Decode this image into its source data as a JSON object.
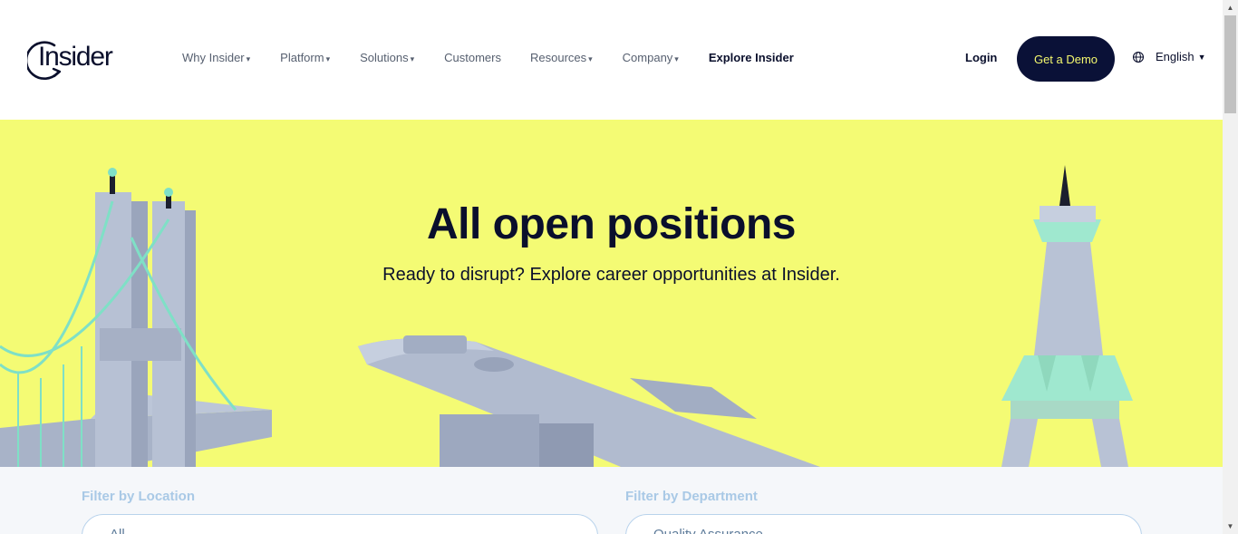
{
  "header": {
    "logo_text": "Insider",
    "nav": [
      {
        "label": "Why Insider",
        "has_caret": true
      },
      {
        "label": "Platform",
        "has_caret": true
      },
      {
        "label": "Solutions",
        "has_caret": true
      },
      {
        "label": "Customers",
        "has_caret": false
      },
      {
        "label": "Resources",
        "has_caret": true
      },
      {
        "label": "Company",
        "has_caret": true
      },
      {
        "label": "Explore Insider",
        "has_caret": false
      }
    ],
    "caret": "▾",
    "login_label": "Login",
    "demo_label": "Get a Demo",
    "language": "English",
    "language_caret": "▼"
  },
  "hero": {
    "title": "All open positions",
    "subtitle": "Ready to disrupt? Explore career opportunities at Insider."
  },
  "filters": {
    "location_label": "Filter by Location",
    "location_value": "All",
    "department_label": "Filter by Department",
    "department_value": "Quality Assurance"
  },
  "scrollbar": {
    "up_arrow": "▲",
    "down_arrow": "▼"
  },
  "colors": {
    "hero_bg": "#f4fb74",
    "navy": "#0a1137",
    "demo_text": "#f4f86e",
    "filter_label": "#a9c9e6"
  },
  "icons": [
    "globe-icon",
    "caret-down-icon",
    "logo-ring-icon"
  ]
}
